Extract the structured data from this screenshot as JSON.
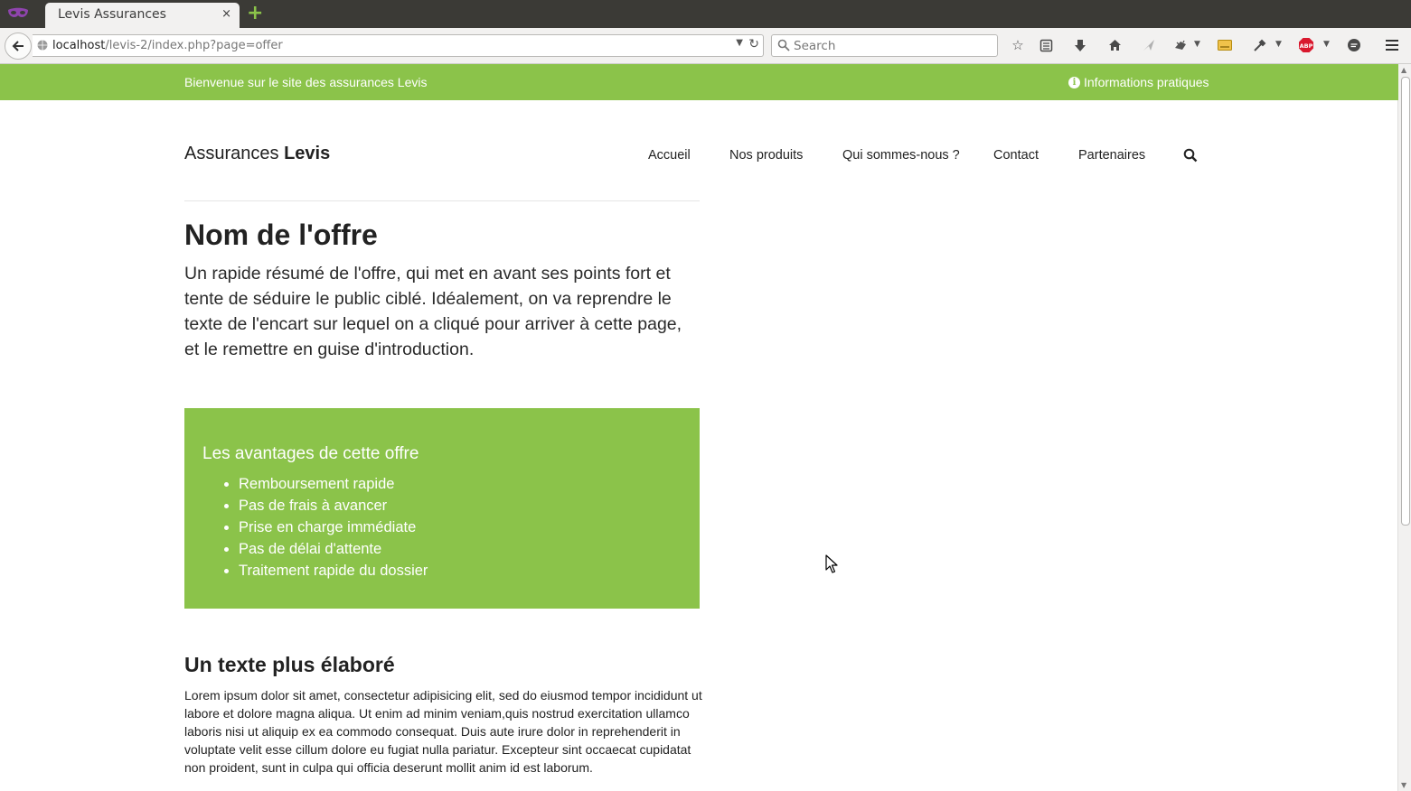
{
  "browser": {
    "tab_title": "Levis Assurances",
    "tab_close": "×",
    "new_tab": "+",
    "url_host": "localhost",
    "url_path": "/levis-2/index.php?page=offer",
    "search_placeholder": "Search",
    "toolbar_icons": [
      "bookmark-star-icon",
      "reading-list-icon",
      "download-icon",
      "home-icon",
      "send-icon",
      "extension-icon",
      "rss-icon",
      "eyedropper-icon",
      "adblock-icon",
      "chat-icon",
      "menu-icon"
    ],
    "adblock_label": "ABP"
  },
  "topbar": {
    "welcome": "Bienvenue sur le site des assurances Levis",
    "info": "Informations pratiques"
  },
  "header": {
    "brand_prefix": "Assurances",
    "brand_name": "Levis",
    "nav": [
      "Accueil",
      "Nos produits",
      "Qui sommes-nous ?",
      "Contact",
      "Partenaires"
    ]
  },
  "offer": {
    "title": "Nom de l'offre",
    "summary": "Un rapide résumé de l'offre, qui met en avant ses points fort et tente de séduire le public ciblé. Idéalement, on va reprendre le texte de l'encart sur lequel on a cliqué pour arriver à cette page, et le remettre en guise d'introduction.",
    "benefits_title": "Les avantages de cette offre",
    "benefits": [
      "Remboursement rapide",
      "Pas de frais à avancer",
      "Prise en charge immédiate",
      "Pas de délai d'attente",
      "Traitement rapide du dossier"
    ],
    "section_title": "Un texte plus élaboré",
    "body": "Lorem ipsum dolor sit amet, consectetur adipisicing elit, sed do eiusmod tempor incididunt ut labore et dolore magna aliqua. Ut enim ad minim veniam,quis nostrud exercitation ullamco laboris nisi ut aliquip ex ea commodo consequat. Duis aute irure dolor in reprehenderit in voluptate velit esse cillum dolore eu fugiat nulla pariatur. Excepteur sint occaecat cupidatat non proident, sunt in culpa qui officia deserunt mollit anim id est laborum."
  },
  "colors": {
    "brand_green": "#8bc34a",
    "chrome_dark": "#3b3a36",
    "chrome_light": "#f2f1f0"
  }
}
